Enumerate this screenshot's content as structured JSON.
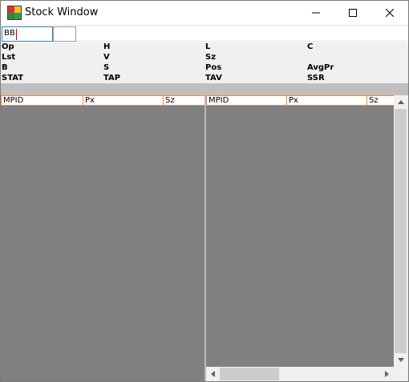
{
  "window": {
    "title": "Stock Window",
    "controls": {
      "minimize_icon": "minimize-icon",
      "maximize_icon": "maximize-icon",
      "close_icon": "close-icon"
    }
  },
  "symbol": {
    "value": "BB"
  },
  "quote_labels": [
    [
      "Op",
      "H",
      "L",
      "C"
    ],
    [
      "Lst",
      "V",
      "Sz",
      ""
    ],
    [
      "B",
      "S",
      "Pos",
      "AvgPr"
    ],
    [
      "STAT",
      "TAP",
      "TAV",
      "SSR"
    ]
  ],
  "bid_book": {
    "columns": [
      "MPID",
      "Px",
      "Sz"
    ]
  },
  "ask_book": {
    "columns": [
      "MPID",
      "Px",
      "Sz"
    ]
  },
  "colors": {
    "book_background": "#808080",
    "header_border": "#e58a4e",
    "status_strip": "#bfbfbf",
    "input_cursor": "#c00000"
  }
}
